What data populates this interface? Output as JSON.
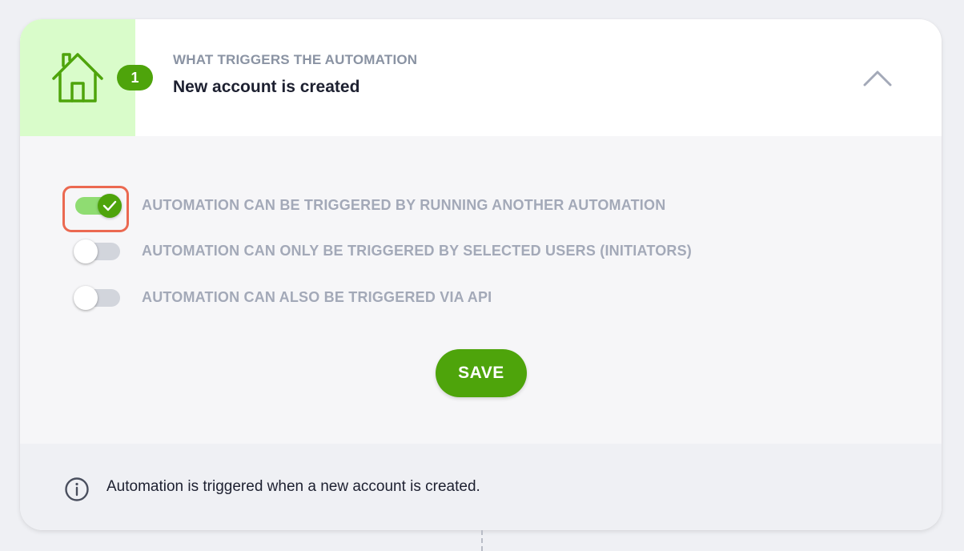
{
  "trigger": {
    "step_number": "1",
    "subtitle": "WHAT TRIGGERS THE AUTOMATION",
    "title": "New account is created",
    "icon": "home-icon",
    "collapse_icon": "chevron-up-icon"
  },
  "options": [
    {
      "label": "AUTOMATION CAN BE TRIGGERED BY RUNNING ANOTHER AUTOMATION",
      "enabled": true
    },
    {
      "label": "AUTOMATION CAN ONLY BE TRIGGERED BY SELECTED USERS (INITIATORS)",
      "enabled": false
    },
    {
      "label": "AUTOMATION CAN ALSO BE TRIGGERED VIA API",
      "enabled": false
    }
  ],
  "save_label": "SAVE",
  "info": {
    "icon": "info-icon",
    "text": "Automation is triggered when a new account is created."
  },
  "colors": {
    "accent": "#4ea40b",
    "icon_panel": "#d9fcca",
    "focus_ring": "#eb6951"
  }
}
